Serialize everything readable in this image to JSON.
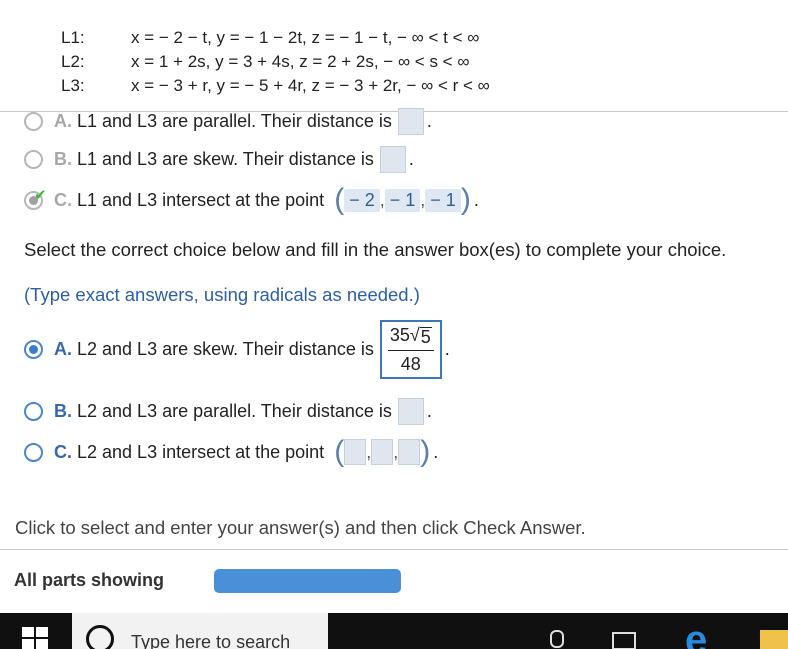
{
  "lines": [
    {
      "name": "L1:",
      "eq": "x = − 2 − t, y = − 1 − 2t, z = − 1 − t, − ∞ < t < ∞"
    },
    {
      "name": "L2:",
      "eq": "x = 1 + 2s, y = 3 + 4s, z = 2 + 2s, − ∞ < s < ∞"
    },
    {
      "name": "L3:",
      "eq": "x = − 3 + r, y = − 5 + 4r, z = − 3 + 2r, − ∞ < r < ∞"
    }
  ],
  "part1": {
    "a": {
      "letter": "A.",
      "text": "L1 and L3 are parallel. Their distance is"
    },
    "b": {
      "letter": "B.",
      "text": "L1 and L3 are skew. Their distance is"
    },
    "c": {
      "letter": "C.",
      "text": "L1 and L3 intersect at the point",
      "point": [
        "− 2",
        "− 1",
        "− 1"
      ]
    }
  },
  "prompt": "Select the correct choice below and fill in the answer box(es) to complete your choice.",
  "hint": "(Type exact answers, using radicals as needed.)",
  "part2": {
    "a": {
      "letter": "A.",
      "text": "L2 and L3 are skew. Their distance is",
      "numerator_coef": "35",
      "radicand": "5",
      "denominator": "48"
    },
    "b": {
      "letter": "B.",
      "text": "L2 and L3 are parallel. Their distance is"
    },
    "c": {
      "letter": "C.",
      "text": "L2 and L3 intersect at the point"
    }
  },
  "period": ".",
  "footer_text": "Click to select and enter your answer(s) and then click Check Answer.",
  "parts_label": "All parts showing",
  "progress_fraction": 1.0,
  "taskbar": {
    "search_placeholder": "Type here to search"
  },
  "colors": {
    "accent": "#3d7cc9",
    "progress": "#4a90d9",
    "check": "#3bb339"
  }
}
